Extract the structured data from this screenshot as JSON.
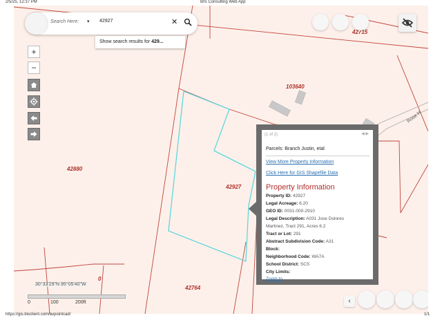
{
  "print_header": {
    "datetime": "2/5/25, 12:37 PM",
    "title": "BIS Consulting Web App"
  },
  "print_footer": {
    "url": "https://gis.bisclient.com/avpointcad/",
    "page": "1/1"
  },
  "search": {
    "placeholder": "Search Here:",
    "caret": "▾",
    "value": "42927",
    "clear_icon": "close-icon",
    "go_icon": "search-icon",
    "suggestion_prefix": "Show search results for ",
    "suggestion_term": "429..."
  },
  "map_tools": {
    "zoom_in": "+",
    "zoom_out": "−",
    "home_icon": "home-icon",
    "locate_icon": "locate-icon",
    "back_icon": "arrow-left-icon",
    "forward_icon": "arrow-right-icon"
  },
  "top_right": {
    "visibility_icon": "eye-off-icon"
  },
  "parcel_labels": [
    "42715",
    "103640",
    "42880",
    "42927",
    "42764",
    "0"
  ],
  "road_label": "Rose H",
  "popup": {
    "pager": "(1 of 2)",
    "nav": "◀ ▶",
    "title": "Parcels: Branch Justin, etal",
    "link_more": "View More Property Information",
    "link_gis": "Click Here for GIS Shapefile Data",
    "section": "Property Information",
    "fields": [
      {
        "label": "Property ID:",
        "value": " 42927"
      },
      {
        "label": "Legal Acreage:",
        "value": " 6.20"
      },
      {
        "label": "GEO ID:",
        "value": " 0031-000-2910"
      },
      {
        "label": "Legal Description:",
        "value": " A031 Jose Dolores"
      },
      {
        "label": "",
        "value": "Martinez, Tract 291, Acres 6.2"
      },
      {
        "label": "Tract or Lot:",
        "value": " 291"
      },
      {
        "label": "Abstract Subdivision Code:",
        "value": " A31"
      },
      {
        "label": "Block:",
        "value": ""
      },
      {
        "label": "Neighborhood Code:",
        "value": " WA7A"
      },
      {
        "label": "School District:",
        "value": " SCS"
      },
      {
        "label": "City Limits:",
        "value": ""
      }
    ],
    "zoom_link": "Zoom to"
  },
  "coordinates": "30°33'29\"N 95°05'40\"W",
  "scale": {
    "labels": [
      "0",
      "100",
      "200ft"
    ]
  },
  "bottom_right": {
    "prev_icon": "chevron-left-icon",
    "prev_glyph": "‹"
  },
  "colors": {
    "parcel_line": "#c0443c",
    "selected_parcel": "#5fd6dc",
    "map_bg": "#fdf0ea",
    "label_red": "#b0302a",
    "link_blue": "#2a6fb0"
  }
}
